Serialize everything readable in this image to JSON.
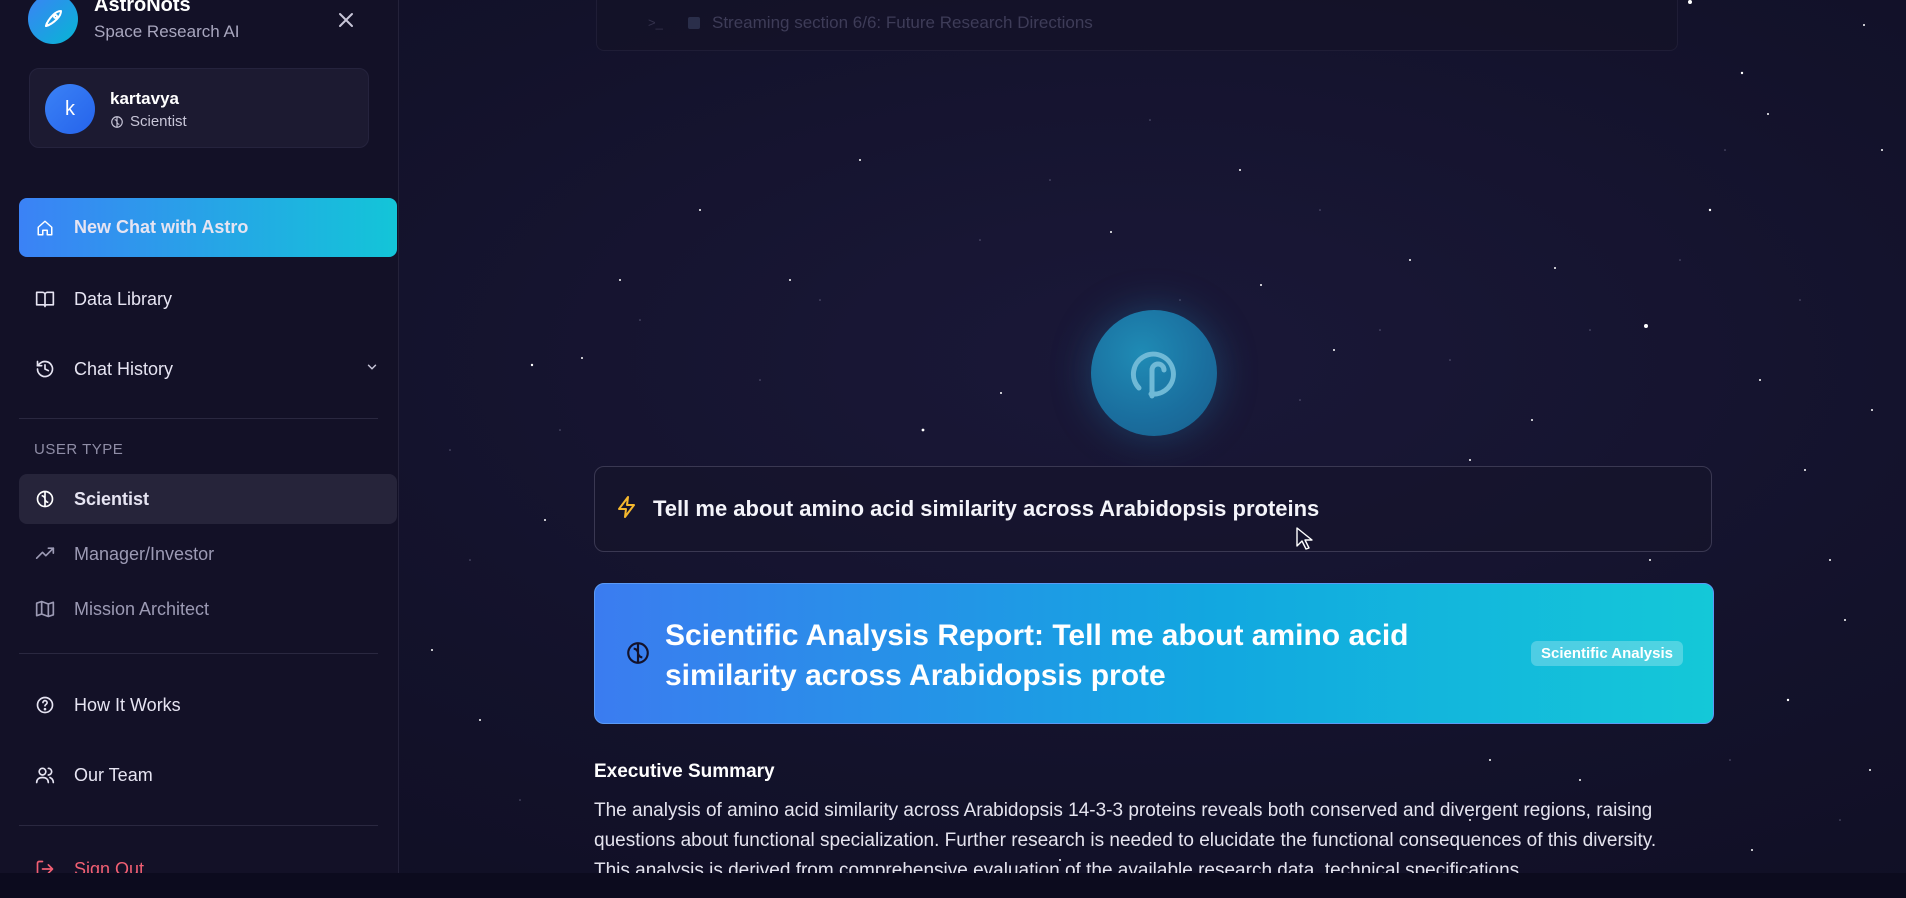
{
  "sidebar": {
    "brand_title": "AstroNots",
    "brand_subtitle": "Space Research AI",
    "user": {
      "initial": "k",
      "name": "kartavya",
      "role": "Scientist"
    },
    "nav": {
      "new_chat": "New Chat with Astro",
      "data_library": "Data Library",
      "chat_history": "Chat History"
    },
    "user_type_label": "USER TYPE",
    "user_types": [
      "Scientist",
      "Manager/Investor",
      "Mission Architect"
    ],
    "footer": {
      "how_it_works": "How It Works",
      "our_team": "Our Team",
      "sign_out": "Sign Out"
    }
  },
  "main": {
    "streaming_status": "Streaming section 6/6: Future Research Directions",
    "query": "Tell me about amino acid similarity across Arabidopsis proteins",
    "report_title": "Scientific Analysis Report: Tell me about amino acid similarity across Arabidopsis prote",
    "report_badge": "Scientific Analysis",
    "exec_summary_title": "Executive Summary",
    "exec_summary_body": "The analysis of amino acid similarity across Arabidopsis 14-3-3 proteins reveals both conserved and divergent regions, raising questions about functional specialization. Further research is needed to elucidate the functional consequences of this diversity. This analysis is derived from comprehensive evaluation of the available research data, technical specifications"
  },
  "colors": {
    "accent_start": "#3b82f6",
    "accent_end": "#13c5d8",
    "sign_out": "#f25f73",
    "background": "#13122b"
  }
}
